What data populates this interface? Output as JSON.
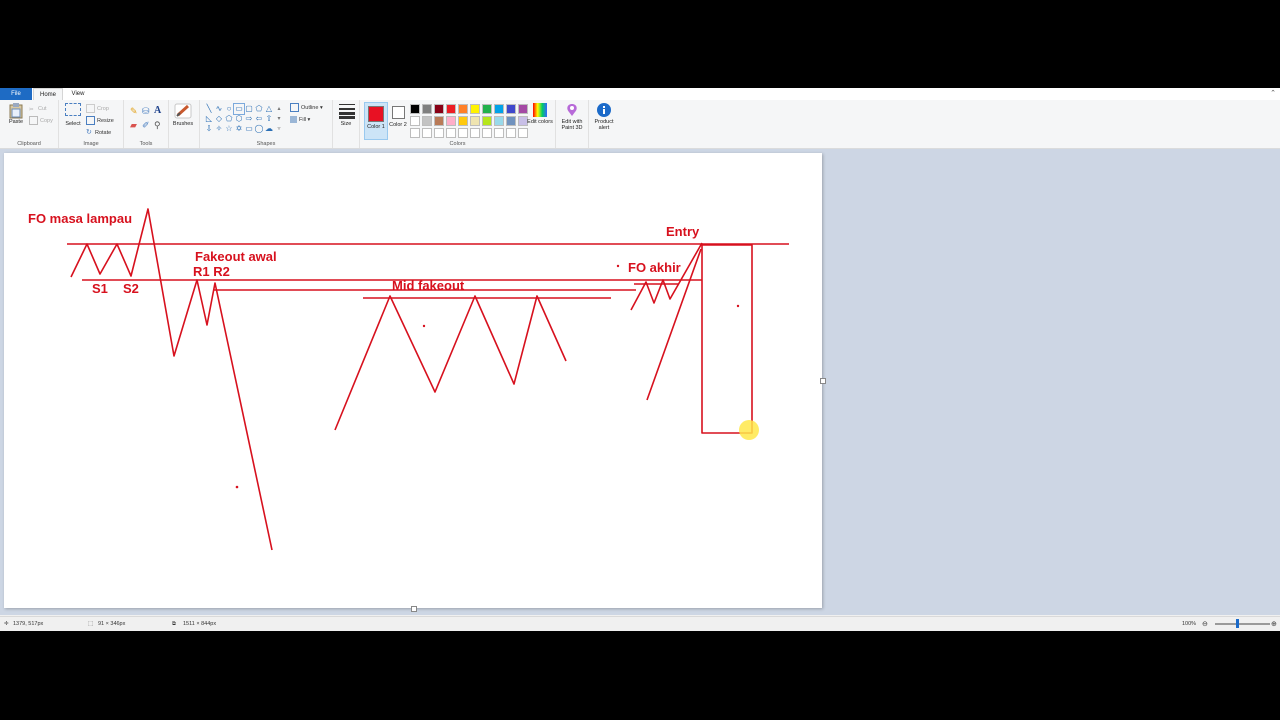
{
  "tabs": {
    "file": "File",
    "home": "Home",
    "view": "View"
  },
  "clipboard": {
    "paste": "Paste",
    "cut": "Cut",
    "copy": "Copy",
    "label": "Clipboard"
  },
  "image": {
    "select": "Select",
    "crop": "Crop",
    "resize": "Resize",
    "rotate": "Rotate",
    "label": "Image"
  },
  "tools": {
    "label": "Tools",
    "text_glyph": "A"
  },
  "brushes": {
    "label": "Brushes"
  },
  "shapes": {
    "label": "Shapes",
    "outline": "Outline",
    "fill": "Fill"
  },
  "size": {
    "label": "Size"
  },
  "colors": {
    "color1": "Color 1",
    "color2": "Color 2",
    "edit": "Edit colors",
    "label": "Colors",
    "color1_value": "#e81123",
    "color2_value": "#ffffff",
    "palette": [
      "#000000",
      "#7f7f7f",
      "#880015",
      "#ed1c24",
      "#ff7f27",
      "#fff200",
      "#22b14c",
      "#00a2e8",
      "#3f48cc",
      "#a349a4",
      "#ffffff",
      "#c3c3c3",
      "#b97a57",
      "#ffaec9",
      "#ffc90e",
      "#efe4b0",
      "#b5e61d",
      "#99d9ea",
      "#7092be",
      "#c8bfe7"
    ]
  },
  "paint3d": {
    "label": "Edit with Paint 3D"
  },
  "product_alert": {
    "label": "Product alert"
  },
  "annotations": {
    "fo_masa_lampau": "FO masa lampau",
    "entry": "Entry",
    "fakeout_awal": "Fakeout awal",
    "r1_r2": "R1 R2",
    "s1": "S1",
    "s2": "S2",
    "mid_fakeout": "Mid fakeout",
    "fo_akhir": "FO akhir"
  },
  "status": {
    "cursor": "1379, 517px",
    "selection": "91 × 346px",
    "image_size": "1511 × 844px",
    "zoom": "100%"
  }
}
